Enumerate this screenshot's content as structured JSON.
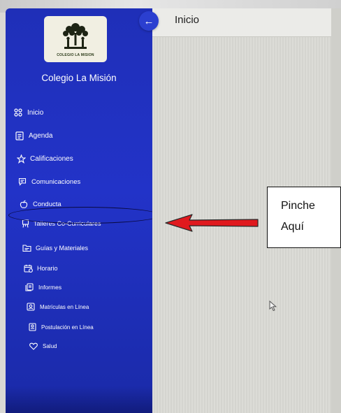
{
  "header": {
    "title": "Inicio"
  },
  "school": {
    "name": "Colegio La Misión",
    "logo_text": "COLEGIO LA MISION"
  },
  "sidebar": {
    "items": [
      {
        "label": "Inicio",
        "icon": "grid-icon"
      },
      {
        "label": "Agenda",
        "icon": "agenda-icon"
      },
      {
        "label": "Calificaciones",
        "icon": "star-icon"
      },
      {
        "label": "Comunicaciones",
        "icon": "message-icon"
      },
      {
        "label": "Conducta",
        "icon": "apple-icon"
      },
      {
        "label": "Talleres Co-Curriculares",
        "icon": "easel-icon"
      },
      {
        "label": "Guías y Materiales",
        "icon": "folder-icon"
      },
      {
        "label": "Horario",
        "icon": "calendar-icon"
      },
      {
        "label": "Informes",
        "icon": "report-icon"
      },
      {
        "label": "Matrículas en Línea",
        "icon": "enrollment-icon"
      },
      {
        "label": "Postulación en Línea",
        "icon": "application-icon"
      },
      {
        "label": "Salud",
        "icon": "heart-icon"
      }
    ]
  },
  "annotation": {
    "line1": "Pinche",
    "line2": "Aquí"
  },
  "colors": {
    "sidebar": "#2233c8",
    "back_button": "#2b3fd0",
    "arrow": "#e0191e",
    "highlight": "#0a0a40"
  }
}
